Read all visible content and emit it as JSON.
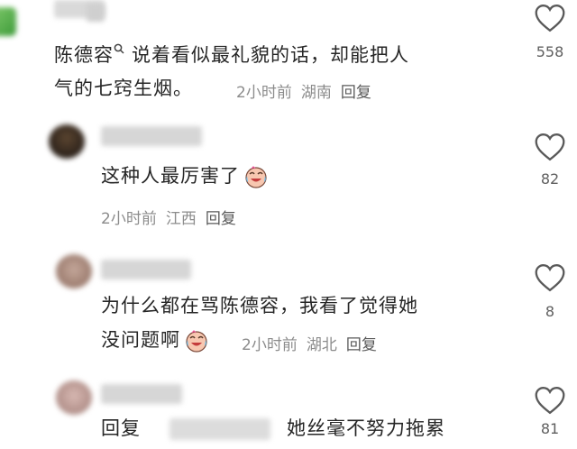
{
  "comments": [
    {
      "mention": "陈德容",
      "line1": "说着看似最礼貌的话，却能把人",
      "line2": "气的七窍生烟。",
      "time": "2小时前",
      "location": "湖南",
      "reply": "回复",
      "likes": "558"
    },
    {
      "line1": "这种人最厉害了",
      "time": "2小时前",
      "location": "江西",
      "reply": "回复",
      "likes": "82"
    },
    {
      "line1": "为什么都在骂陈德容，我看了觉得她",
      "line2": "没问题啊",
      "time": "2小时前",
      "location": "湖北",
      "reply": "回复",
      "likes": "8"
    },
    {
      "prefix": "回复",
      "line1": "她丝毫不努力拖累",
      "likes": "81"
    }
  ],
  "colors": {
    "text": "#262626",
    "meta": "#8c8c8c",
    "heart": "#5a5a5a"
  }
}
